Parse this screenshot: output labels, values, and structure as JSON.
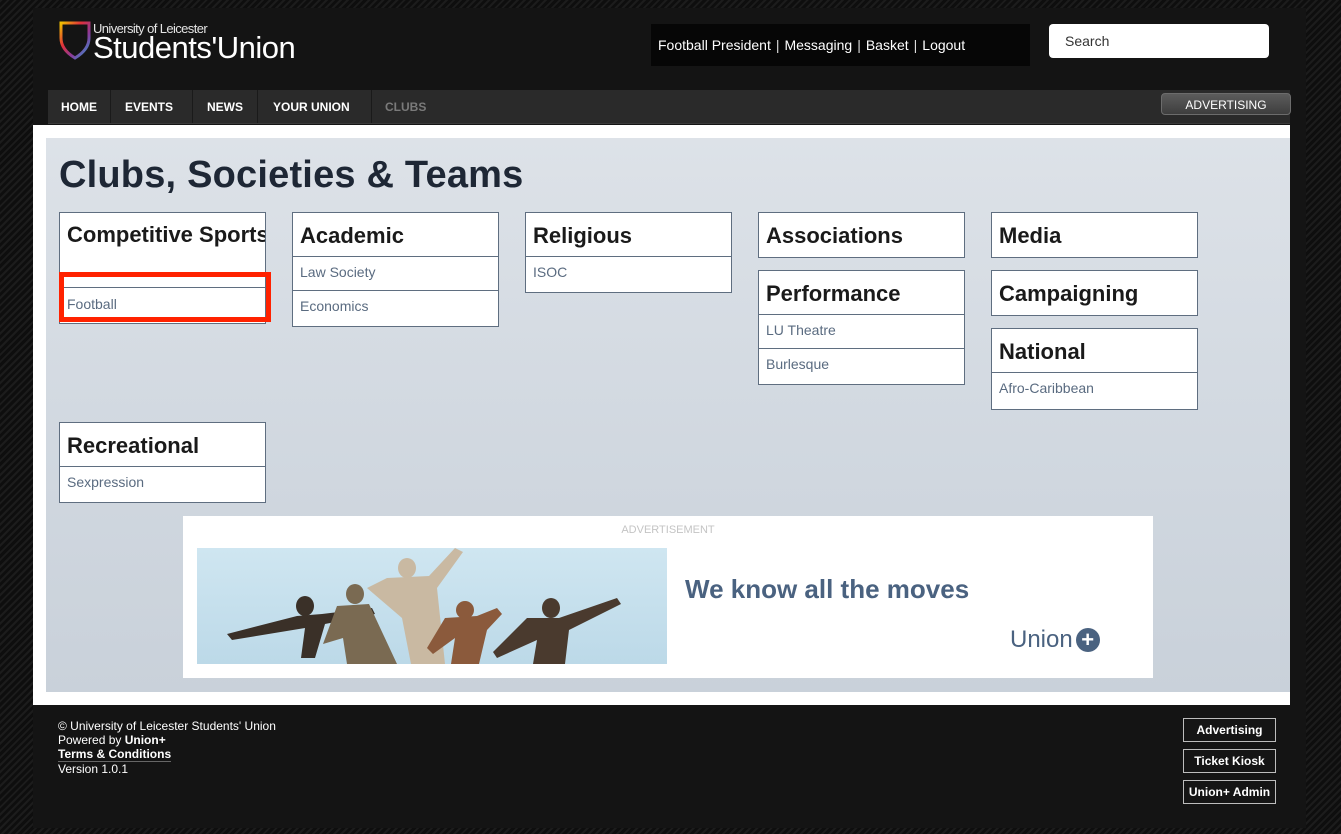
{
  "header": {
    "logo_small": "University of Leicester",
    "logo_big": "Students'Union",
    "user_links": [
      "Football President",
      "Messaging",
      "Basket",
      "Logout"
    ],
    "search_placeholder": "Search"
  },
  "nav": {
    "items": [
      "HOME",
      "EVENTS",
      "NEWS",
      "YOUR UNION",
      "CLUBS"
    ],
    "advertising_button": "ADVERTISING"
  },
  "main": {
    "title": "Clubs, Societies & Teams",
    "categories": [
      {
        "name": "Competitive Sports",
        "links": [
          "Football"
        ]
      },
      {
        "name": "Academic",
        "links": [
          "Law Society",
          "Economics"
        ]
      },
      {
        "name": "Religious",
        "links": [
          "ISOC"
        ]
      },
      {
        "name": "Associations",
        "links": []
      },
      {
        "name": "Performance",
        "links": [
          "LU Theatre",
          "Burlesque"
        ]
      },
      {
        "name": "Media",
        "links": []
      },
      {
        "name": "Campaigning",
        "links": []
      },
      {
        "name": "National",
        "links": [
          "Afro-Caribbean"
        ]
      },
      {
        "name": "Recreational",
        "links": [
          "Sexpression"
        ]
      }
    ]
  },
  "ad": {
    "label": "ADVERTISEMENT",
    "slogan": "We know all the moves",
    "brand": "Union",
    "brand_symbol": "+"
  },
  "footer": {
    "copyright": "© University of Leicester Students' Union",
    "powered_prefix": "Powered by",
    "powered_brand": "Union+",
    "terms": "Terms & Conditions",
    "version": "Version 1.0.1",
    "buttons": [
      "Advertising",
      "Ticket Kiosk",
      "Union+ Admin"
    ]
  },
  "colors": {
    "highlight": "#ff2200",
    "link": "#5a6b80",
    "title": "#1e2735"
  }
}
